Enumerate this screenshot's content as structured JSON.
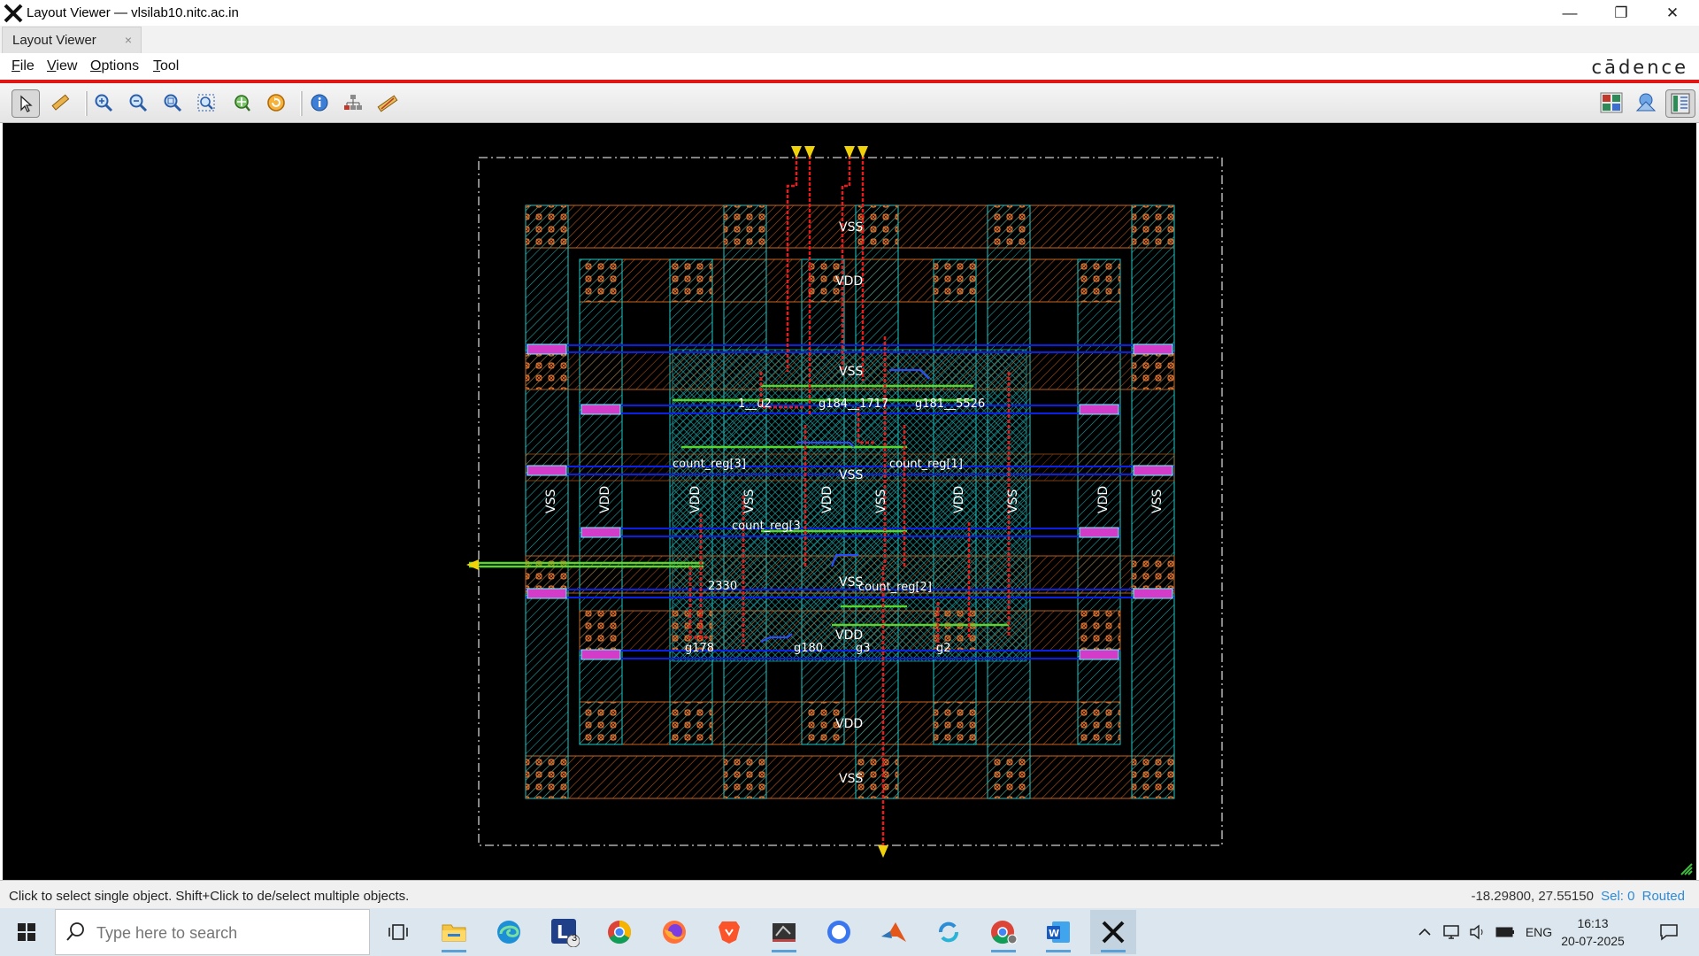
{
  "window": {
    "title": "Layout Viewer — vlsilab10.nitc.ac.in",
    "minimize_glyph": "—",
    "maximize_glyph": "❐",
    "close_glyph": "✕"
  },
  "tabs": [
    {
      "label": "Layout Viewer",
      "close_glyph": "×"
    }
  ],
  "menu": {
    "file": "File",
    "view": "View",
    "options": "Options",
    "tool": "Tool"
  },
  "brand": {
    "logo_text": "cādence",
    "accent": "#e01616"
  },
  "toolbar": {
    "icons": [
      "select-pointer-icon",
      "ruler-icon",
      "zoom-in-icon",
      "zoom-out-icon",
      "zoom-fit-icon",
      "zoom-box-icon",
      "pan-icon",
      "refresh-icon",
      "info-icon",
      "hierarchy-icon",
      "measure-icon",
      "layers-palette-icon",
      "shapes-icon",
      "panel-toggle-icon"
    ]
  },
  "layout": {
    "net_labels": {
      "vss": "VSS",
      "vdd": "VDD",
      "g184": "g184__1717",
      "g181": "g181__5526",
      "u2": "1__u2",
      "count_reg3": "count_reg[3]",
      "count_reg1": "count_reg[1]",
      "count_reg_mid": "count_reg[3",
      "count_reg2": "count_reg[2]",
      "n2330": "2330",
      "g178": "g178",
      "g180": "g180",
      "g3": "g3",
      "g2": "g2"
    },
    "colors": {
      "metal1": "#0a20e6",
      "metal2": "#e41c1c",
      "poly": "#5ad62a",
      "nwell": "#1ec8c8",
      "diffusion": "#c8641e",
      "pin": "#f0d20a"
    }
  },
  "status": {
    "message": "Click to select single object. Shift+Click to de/select multiple objects.",
    "coordinates": "-18.29800, 27.55150",
    "selection": "Sel: 0",
    "routed": "Routed"
  },
  "taskbar": {
    "search_placeholder": "Type here to search",
    "apps": [
      "task-view-icon",
      "file-explorer-icon",
      "edge-icon",
      "l-app-icon",
      "chrome-icon",
      "firefox-icon",
      "brave-icon",
      "vm-icon",
      "signal-icon",
      "matlab-icon",
      "sync-icon",
      "chrome-profile-icon",
      "word-icon",
      "x-server-icon"
    ],
    "l_app_badge": "3",
    "language": "ENG",
    "time": "16:13",
    "date": "20-07-2025"
  }
}
